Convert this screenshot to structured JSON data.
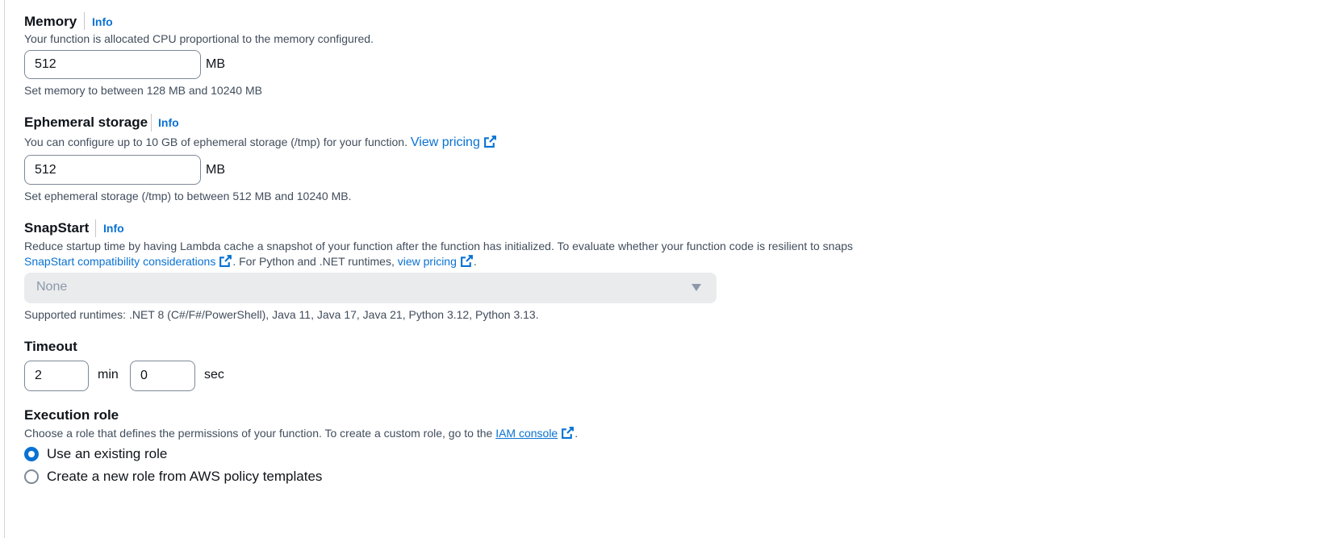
{
  "memory": {
    "title": "Memory",
    "info": "Info",
    "description": "Your function is allocated CPU proportional to the memory configured.",
    "value": "512",
    "unit": "MB",
    "hint": "Set memory to between 128 MB and 10240 MB"
  },
  "ephemeral": {
    "title": "Ephemeral storage",
    "info": "Info",
    "description": "You can configure up to 10 GB of ephemeral storage (/tmp) for your function.",
    "pricing_link": "View pricing",
    "value": "512",
    "unit": "MB",
    "hint": "Set ephemeral storage (/tmp) to between 512 MB and 10240 MB."
  },
  "snapstart": {
    "title": "SnapStart",
    "info": "Info",
    "description": "Reduce startup time by having Lambda cache a snapshot of your function after the function has initialized. To evaluate whether your function code is resilient to snaps",
    "compat_link": "SnapStart compatibility considerations",
    "runtime_text": ". For Python and .NET runtimes,",
    "pricing_link": "view pricing",
    "period": ".",
    "selected": "None",
    "hint": "Supported runtimes: .NET 8 (C#/F#/PowerShell), Java 11, Java 17, Java 21, Python 3.12, Python 3.13."
  },
  "timeout": {
    "title": "Timeout",
    "min_value": "2",
    "min_unit": "min",
    "sec_value": "0",
    "sec_unit": "sec"
  },
  "execution_role": {
    "title": "Execution role",
    "description": "Choose a role that defines the permissions of your function. To create a custom role, go to the",
    "iam_link": "IAM console",
    "period": ".",
    "options": [
      {
        "label": "Use an existing role",
        "checked": true
      },
      {
        "label": "Create a new role from AWS policy templates",
        "checked": false
      }
    ]
  },
  "colors": {
    "link": "#0972d3",
    "text": "#0f141a",
    "secondary_text": "#414d5c",
    "disabled_bg": "#e9ebed"
  },
  "icons": {
    "external": "external-link-icon",
    "caret": "caret-down-icon"
  }
}
